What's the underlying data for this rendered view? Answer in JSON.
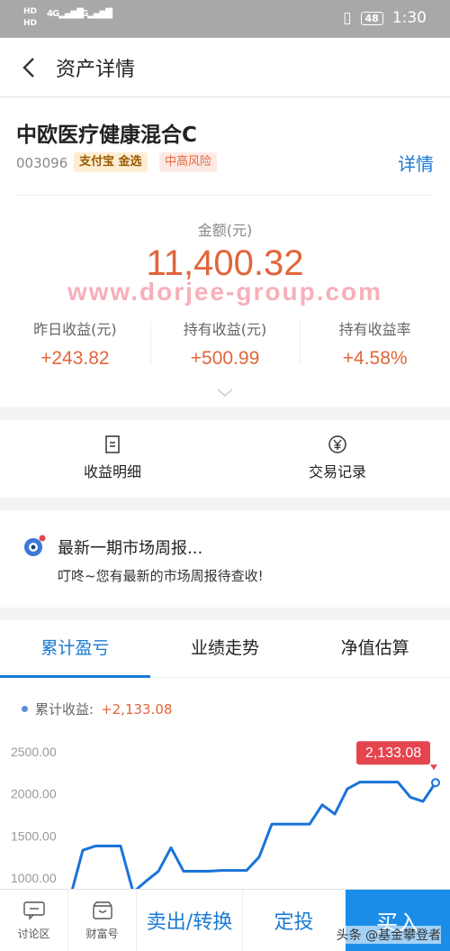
{
  "statusbar": {
    "net1": "HD",
    "net2": "HD",
    "sig1": "4G",
    "sig2": "4G",
    "battery": "48",
    "time": "1:30"
  },
  "nav": {
    "title": "资产详情"
  },
  "fund": {
    "name": "中欧医疗健康混合C",
    "code": "003096",
    "tag_platform": "支付宝 金选",
    "tag_risk": "中高风险",
    "detail_link": "详情",
    "amount_label": "金额(元)",
    "amount": "11,400.32",
    "watermark": "www.dorjee-group.com",
    "stats": [
      {
        "label": "昨日收益(元)",
        "value": "+243.82"
      },
      {
        "label": "持有收益(元)",
        "value": "+500.99"
      },
      {
        "label": "持有收益率",
        "value": "+4.58%"
      }
    ]
  },
  "actions": [
    {
      "label": "收益明细",
      "icon": "document-icon"
    },
    {
      "label": "交易记录",
      "icon": "yen-circle-icon"
    }
  ],
  "report": {
    "title": "最新一期市场周报...",
    "subtitle": "叮咚~您有最新的市场周报待查收!"
  },
  "tabs": [
    "累计盈亏",
    "业绩走势",
    "净值估算"
  ],
  "cumulative": {
    "label": "累计收益:",
    "value": "+2,133.08"
  },
  "chart_data": {
    "type": "line",
    "title": "",
    "xlabel": "",
    "ylabel": "",
    "y_ticks": [
      "2500.00",
      "2000.00",
      "1500.00",
      "1000.00"
    ],
    "ylim": [
      1000,
      2500
    ],
    "series": [
      {
        "color": "#1a73d9",
        "values": [
          770,
          1330,
          1380,
          1380,
          1380,
          830,
          960,
          1080,
          1360,
          1080,
          1080,
          1080,
          1090,
          1090,
          1090,
          1250,
          1640,
          1640,
          1640,
          1640,
          1870,
          1760,
          2060,
          2140,
          2140,
          2140,
          2140,
          1960,
          1910,
          2133.08
        ]
      }
    ],
    "last_value_label": "2,133.08",
    "label_color": "#e5454f",
    "grid": false
  },
  "bottombar": {
    "discuss": "讨论区",
    "wealth": "财富号",
    "sell": "卖出/转换",
    "fixed": "定投",
    "buy": "买入",
    "credit": "头条 @基金攀登者"
  }
}
